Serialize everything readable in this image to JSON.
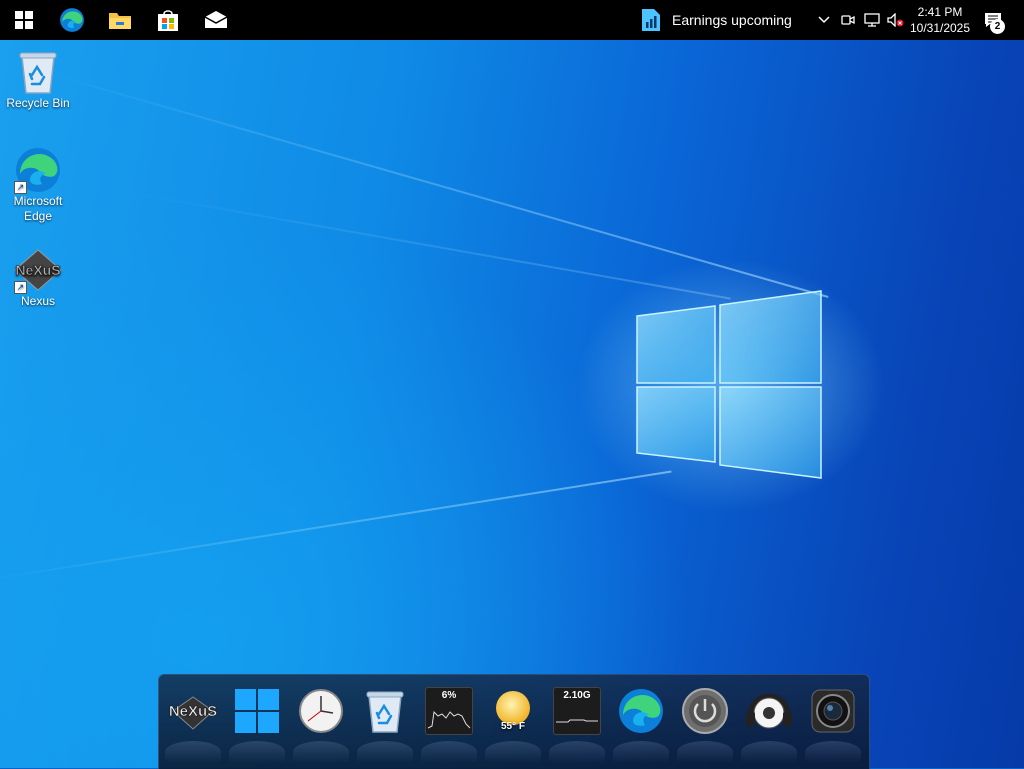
{
  "taskbar": {
    "pinned": [
      {
        "name": "start-button",
        "icon": "windows-logo-icon"
      },
      {
        "name": "edge-taskbar-button",
        "icon": "edge-icon"
      },
      {
        "name": "file-explorer-taskbar-button",
        "icon": "folder-icon"
      },
      {
        "name": "store-taskbar-button",
        "icon": "store-bag-icon"
      },
      {
        "name": "mail-taskbar-button",
        "icon": "mail-icon"
      }
    ],
    "news_widget": {
      "icon": "stock-chart-icon",
      "text": "Earnings upcoming"
    },
    "tray_icons": [
      "chevron-up-icon",
      "meet-now-icon",
      "network-disconnected-icon",
      "volume-muted-icon"
    ],
    "clock": {
      "time": "2:41 PM",
      "date": "10/31/2025"
    },
    "notifications": {
      "count": "2"
    }
  },
  "desktop_icons": [
    {
      "label": "Recycle Bin",
      "icon": "recycle-bin-icon"
    },
    {
      "label": "Microsoft Edge",
      "icon": "edge-icon"
    },
    {
      "label": "Nexus",
      "icon": "nexus-icon"
    }
  ],
  "dock": {
    "items": [
      {
        "name": "nexus",
        "icon": "nexus-icon"
      },
      {
        "name": "windows",
        "icon": "windows-logo-icon"
      },
      {
        "name": "clock",
        "icon": "clock-icon"
      },
      {
        "name": "recycle-bin",
        "icon": "recycle-bin-icon"
      },
      {
        "name": "cpu-meter",
        "icon": "cpu-meter-icon",
        "value": "6%"
      },
      {
        "name": "weather",
        "icon": "sun-icon",
        "value": "55° F"
      },
      {
        "name": "memory-meter",
        "icon": "memory-meter-icon",
        "value": "2.10G"
      },
      {
        "name": "edge",
        "icon": "edge-icon"
      },
      {
        "name": "power",
        "icon": "power-icon"
      },
      {
        "name": "music-player",
        "icon": "headphones-icon"
      },
      {
        "name": "camera",
        "icon": "camera-lens-icon"
      }
    ]
  },
  "colors": {
    "taskbar": "#000000",
    "desktop_blue": "#0a66d6",
    "logo_glow": "#9fe6ff"
  }
}
